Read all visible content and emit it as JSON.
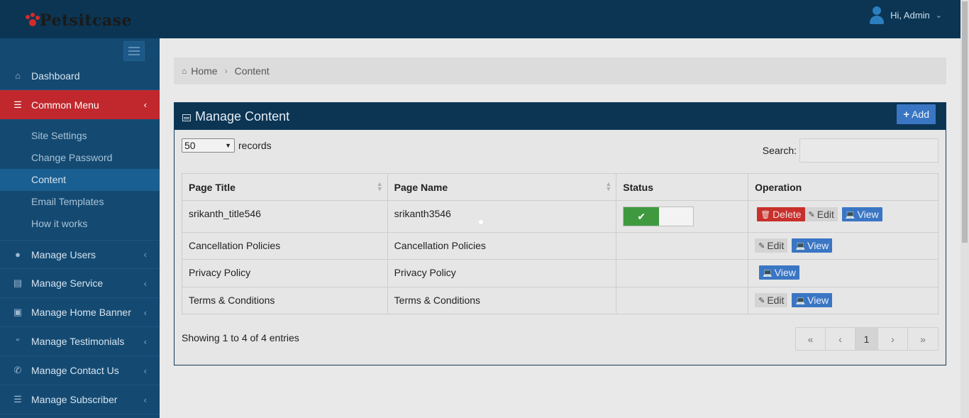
{
  "header": {
    "logo_text": "Petsitcase",
    "user_greeting": "Hi, Admin",
    "brand_color": "#0b3553",
    "accent_red": "#c0282d"
  },
  "sidebar": {
    "items": [
      {
        "label": "Dashboard",
        "icon": "home-icon"
      },
      {
        "label": "Common Menu",
        "icon": "list-icon",
        "active": true
      },
      {
        "label": "Manage Users",
        "icon": "users-icon"
      },
      {
        "label": "Manage Service",
        "icon": "list-alt-icon"
      },
      {
        "label": "Manage Home Banner",
        "icon": "image-icon"
      },
      {
        "label": "Manage Testimonials",
        "icon": "quote-icon"
      },
      {
        "label": "Manage Contact Us",
        "icon": "phone-icon"
      },
      {
        "label": "Manage Subscriber",
        "icon": "server-icon"
      }
    ],
    "submenu": [
      {
        "label": "Site Settings"
      },
      {
        "label": "Change Password"
      },
      {
        "label": "Content",
        "current": true
      },
      {
        "label": "Email Templates"
      },
      {
        "label": "How it works"
      }
    ]
  },
  "breadcrumb": {
    "home": "Home",
    "current": "Content"
  },
  "panel": {
    "title": "Manage Content",
    "add_label": "Add"
  },
  "controls": {
    "records_value": "50",
    "records_label": "records",
    "search_label": "Search:"
  },
  "table": {
    "headers": [
      "Page Title",
      "Page Name",
      "Status",
      "Operation"
    ],
    "rows": [
      {
        "title": "srikanth_title546",
        "name": "srikanth3546",
        "status": "on"
      },
      {
        "title": "Cancellation Policies",
        "name": "Cancellation Policies"
      },
      {
        "title": "Privacy Policy",
        "name": "Privacy Policy"
      },
      {
        "title": "Terms & Conditions",
        "name": "Terms & Conditions"
      }
    ],
    "delete_label": "Delete",
    "edit_label": "Edit",
    "view_label": "View"
  },
  "footer": {
    "info": "Showing 1 to 4 of 4 entries",
    "pager": {
      "first": "«",
      "prev": "‹",
      "page": "1",
      "next": "›",
      "last": "»"
    }
  }
}
